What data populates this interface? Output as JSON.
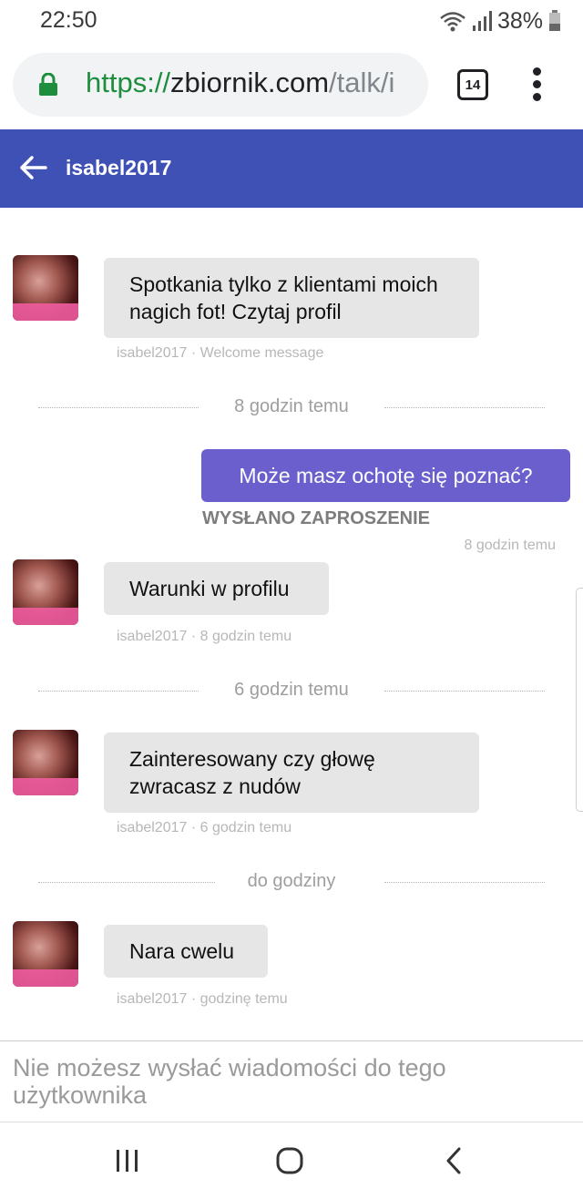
{
  "status_bar": {
    "time": "22:50",
    "battery": "38%"
  },
  "browser": {
    "url_scheme": "https://",
    "url_host": "zbiornik.com",
    "url_path": "/talk/i",
    "tab_count": "14"
  },
  "header": {
    "title": "isabel2017"
  },
  "messages": [
    {
      "text": "Spotkania tylko z klientami moich nagich fot! Czytaj profil",
      "meta": "isabel2017 · Welcome message"
    },
    {
      "text": "Warunki w profilu",
      "meta": "isabel2017 · 8 godzin temu"
    },
    {
      "text": "Zainteresowany czy głowę zwracasz z nudów",
      "meta": "isabel2017 · 6 godzin temu"
    },
    {
      "text": "Nara cwelu",
      "meta": "isabel2017 · godzinę temu"
    }
  ],
  "dividers": [
    "8 godzin temu",
    "6 godzin temu",
    "do godziny"
  ],
  "outgoing": {
    "text": "Może masz ochotę się poznać?",
    "status": "WYSŁANO ZAPROSZENIE",
    "time": "8 godzin temu"
  },
  "composer": {
    "disabled_text": "Nie możesz wysłać wiadomości do tego użytkownika"
  },
  "colors": {
    "header_bg": "#3f51b5",
    "outgoing_bubble": "#6a5fcd",
    "incoming_bubble": "#e6e6e6",
    "url_green": "#1e8e3e"
  },
  "icons": [
    "wifi-icon",
    "signal-icon",
    "battery-icon",
    "lock-icon",
    "tabs-icon",
    "more-menu-icon",
    "back-arrow-icon",
    "recent-apps-icon",
    "home-icon",
    "nav-back-icon"
  ]
}
